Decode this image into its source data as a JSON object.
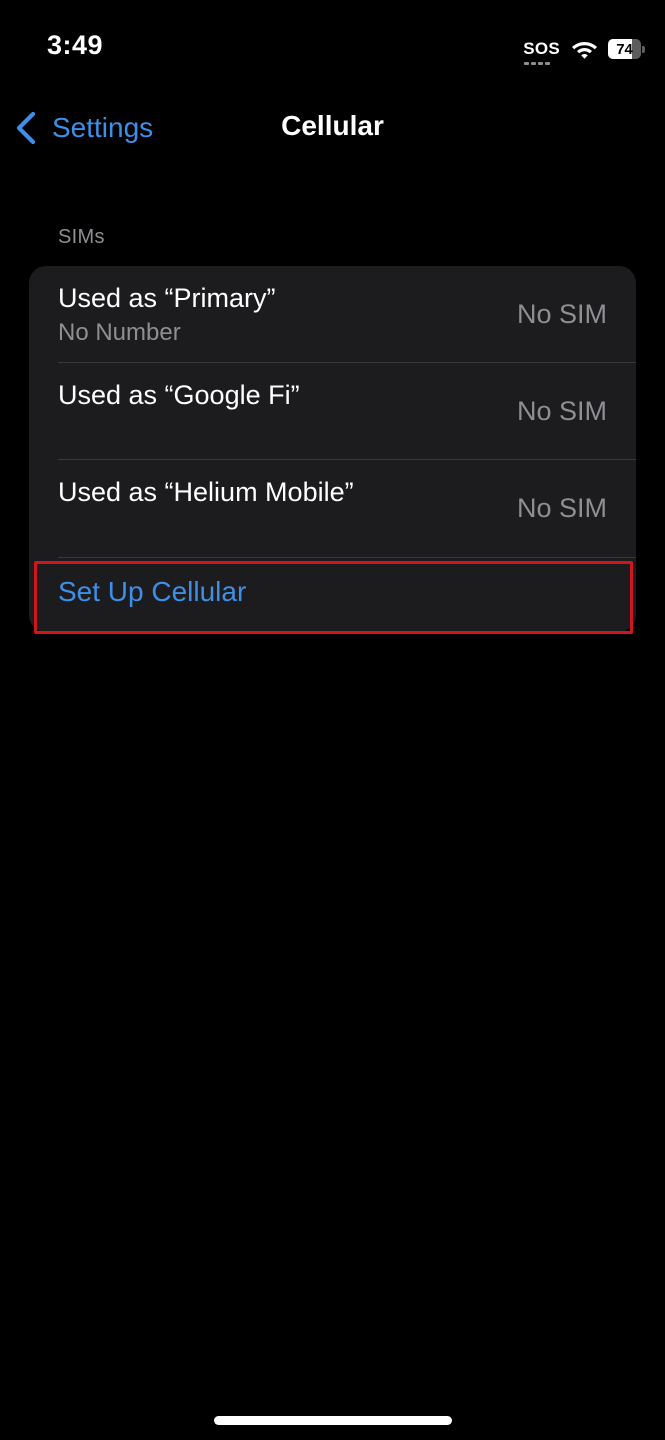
{
  "status_bar": {
    "time": "3:49",
    "sos_label": "SOS",
    "battery_level": "74",
    "battery_fraction": 0.74
  },
  "nav": {
    "back_label": "Settings",
    "title": "Cellular"
  },
  "sims_section": {
    "header": "SIMs",
    "rows": [
      {
        "title": "Used as “Primary”",
        "subtitle": "No Number",
        "value": "No SIM"
      },
      {
        "title": "Used as “Google Fi”",
        "subtitle": "",
        "value": "No SIM"
      },
      {
        "title": "Used as “Helium Mobile”",
        "subtitle": "",
        "value": "No SIM"
      }
    ],
    "setup_label": "Set Up Cellular"
  },
  "colors": {
    "accent": "#3d8fe8",
    "highlight": "#d2141e",
    "secondary_text": "#8e8e93",
    "group_background": "#1c1c1e"
  },
  "icons": {
    "back": "chevron-left-icon",
    "wifi": "wifi-icon",
    "battery": "battery-icon"
  }
}
